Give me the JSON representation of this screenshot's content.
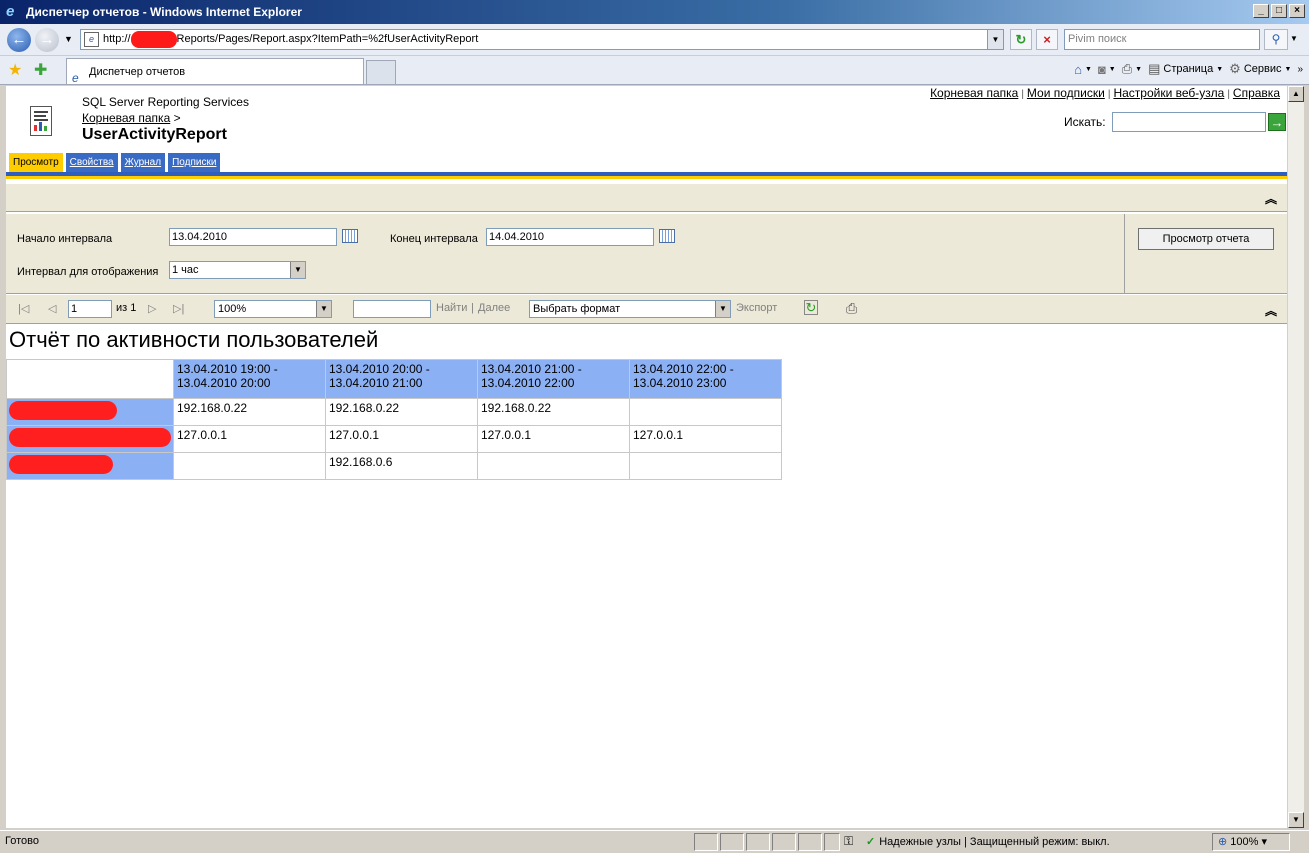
{
  "window": {
    "title": "Диспетчер отчетов - Windows Internet Explorer",
    "buttons": [
      "_",
      "□",
      "×"
    ]
  },
  "address_bar": {
    "url_prefix": "http://",
    "url_suffix": "Reports/Pages/Report.aspx?ItemPath=%2fUserActivityReport",
    "search_placeholder": "Pivim поиск"
  },
  "browser_tab": {
    "label": "Диспетчер отчетов"
  },
  "command_bar": {
    "page_label": "Страница",
    "tools_label": "Сервис"
  },
  "ssrs": {
    "product_name": "SQL Server Reporting Services",
    "breadcrumb_root": "Корневая папка",
    "breadcrumb_sep": ">",
    "report_name": "UserActivityReport",
    "links": [
      "Корневая папка",
      "Мои подписки",
      "Настройки веб-узла",
      "Справка"
    ],
    "link_sep": "|",
    "search_label": "Искать:",
    "tabs": [
      "Просмотр",
      "Свойства",
      "Журнал",
      "Подписки"
    ]
  },
  "parameters": {
    "start_label": "Начало интервала",
    "start_value": "13.04.2010",
    "end_label": "Конец интервала",
    "end_value": "14.04.2010",
    "interval_label": "Интервал для отображения",
    "interval_value": "1 час",
    "view_button": "Просмотр отчета"
  },
  "viewer_toolbar": {
    "page_value": "1",
    "page_of": "из 1",
    "zoom_value": "100%",
    "find_label": "Найти",
    "find_sep": "|",
    "next_label": "Далее",
    "format_value": "Выбрать формат",
    "export_label": "Экспорт"
  },
  "report": {
    "title": "Отчёт по активности пользователей",
    "columns": [
      "13.04.2010 19:00 - 13.04.2010 20:00",
      "13.04.2010 20:00 - 13.04.2010 21:00",
      "13.04.2010 21:00 - 13.04.2010 22:00",
      "13.04.2010 22:00 - 13.04.2010 23:00"
    ],
    "rows": [
      [
        "192.168.0.22",
        "192.168.0.22",
        "192.168.0.22",
        ""
      ],
      [
        "127.0.0.1",
        "127.0.0.1",
        "127.0.0.1",
        "127.0.0.1"
      ],
      [
        "",
        "192.168.0.6",
        "",
        ""
      ]
    ]
  },
  "status_bar": {
    "status": "Готово",
    "zone": "Надежные узлы | Защищенный режим: выкл.",
    "zoom": "100%"
  }
}
